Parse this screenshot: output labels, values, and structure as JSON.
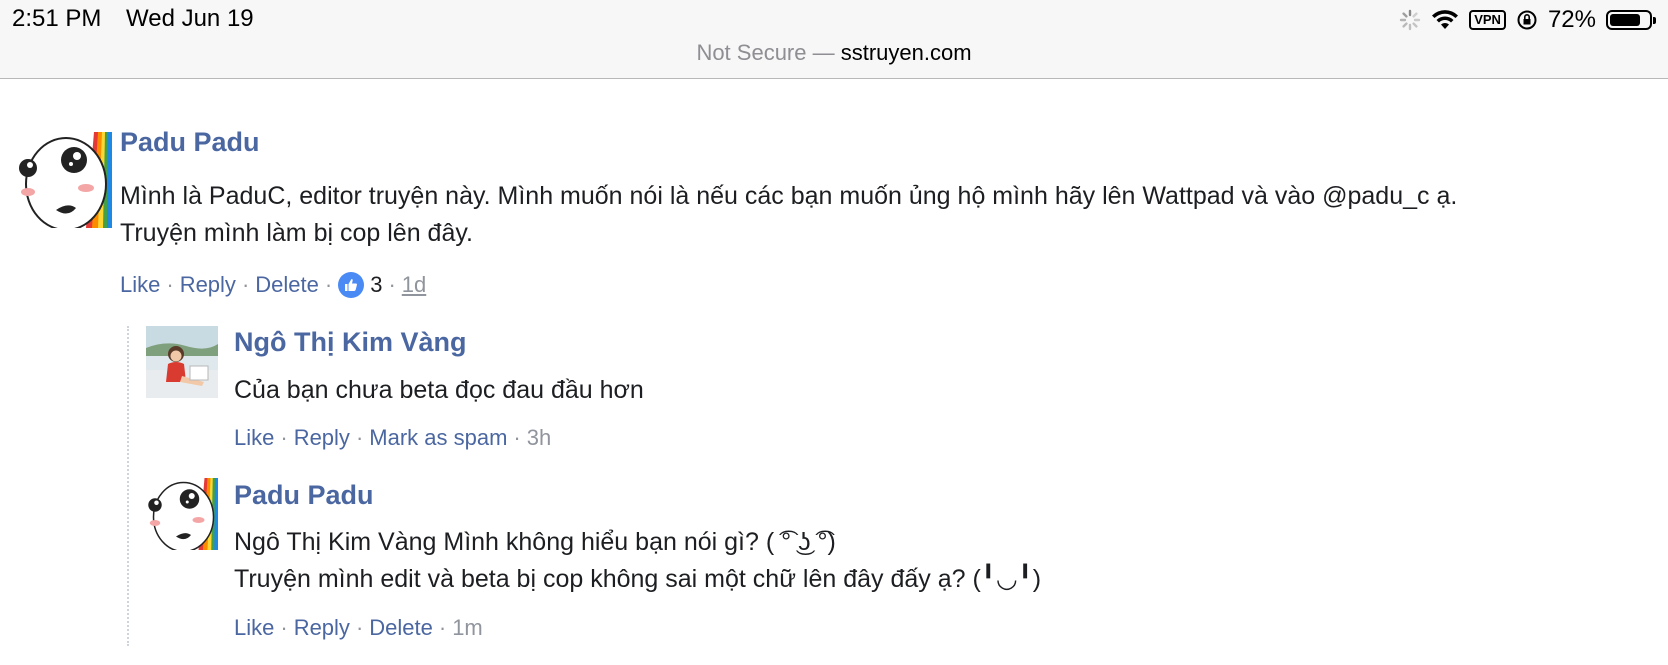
{
  "status_bar": {
    "time": "2:51 PM",
    "date": "Wed Jun 19",
    "vpn": "VPN",
    "battery": "72%"
  },
  "address_bar": {
    "insecure_label": "Not Secure —",
    "domain": "sstruyen.com"
  },
  "comments": [
    {
      "author": "Padu Padu",
      "lines": [
        "Mình là PaduC, editor truyện này. Mình muốn nói là nếu các bạn muốn ủng hộ mình hãy lên Wattpad và vào @padu_c ạ.",
        "Truyện mình làm bị cop lên đây."
      ],
      "actions": {
        "like": "Like",
        "reply": "Reply",
        "delete": "Delete",
        "like_count": "3",
        "time": "1d"
      }
    },
    {
      "author": "Ngô Thị Kim Vàng",
      "lines": [
        "Của bạn chưa beta đọc đau đầu hơn"
      ],
      "actions": {
        "like": "Like",
        "reply": "Reply",
        "spam": "Mark as spam",
        "time": "3h"
      }
    },
    {
      "author": "Padu Padu",
      "lines": [
        "Ngô Thị Kim Vàng Mình không hiểu bạn nói gì? ( ͡° ͜ʖ ͡°)",
        "Truyện mình edit và beta bị cop không sai một chữ lên đây đấy ạ?   (╹◡╹)"
      ],
      "actions": {
        "like": "Like",
        "reply": "Reply",
        "delete": "Delete",
        "time": "1m"
      }
    }
  ],
  "colors": {
    "link": "#4b67a1",
    "meta": "#90949c",
    "text": "#1c1e21",
    "like_badge": "#4a8af4"
  }
}
